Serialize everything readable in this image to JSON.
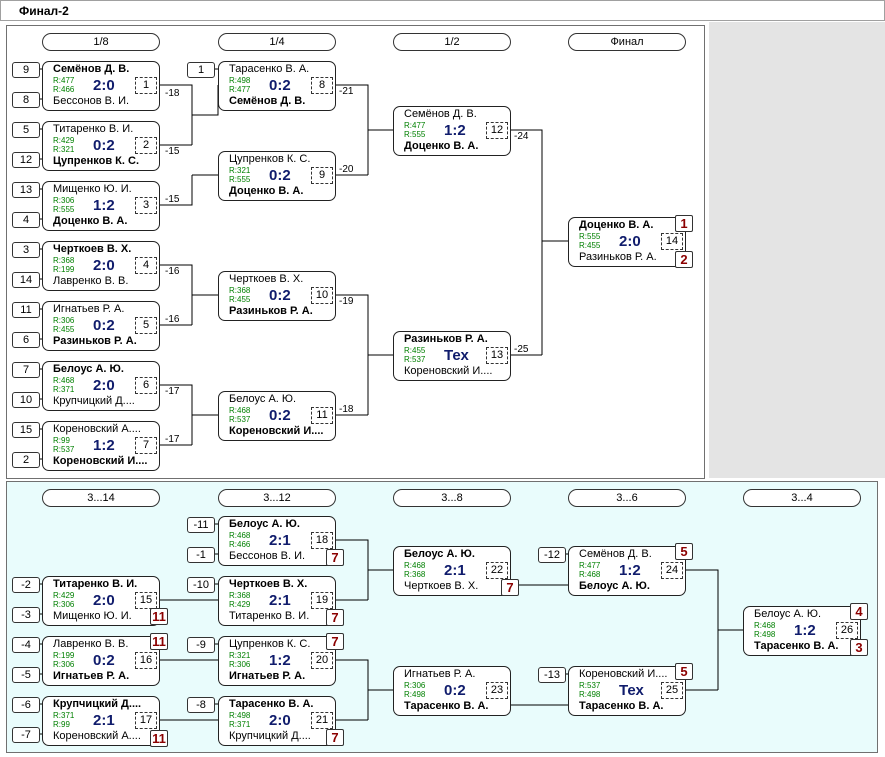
{
  "title": "Финал-2",
  "main_rounds": [
    "1/8",
    "1/4",
    "1/2",
    "Финал"
  ],
  "cons_rounds": [
    "3...14",
    "3...12",
    "3...8",
    "3...6",
    "3...4"
  ],
  "matches": [
    {
      "id": "m1",
      "p1": "Семёнов Д. В.",
      "p2": "Бессонов В. И.",
      "r1": "R:477",
      "r2": "R:466",
      "score": "2:0",
      "num": "1",
      "winner": 1
    },
    {
      "id": "m2",
      "p1": "Титаренко В. И.",
      "p2": "Цупренков К. С.",
      "r1": "R:429",
      "r2": "R:321",
      "score": "0:2",
      "num": "2",
      "winner": 2
    },
    {
      "id": "m3",
      "p1": "Мищенко Ю. И.",
      "p2": "Доценко В. А.",
      "r1": "R:306",
      "r2": "R:555",
      "score": "1:2",
      "num": "3",
      "winner": 2
    },
    {
      "id": "m4",
      "p1": "Черткоев В. Х.",
      "p2": "Лавренко В. В.",
      "r1": "R:368",
      "r2": "R:199",
      "score": "2:0",
      "num": "4",
      "winner": 1
    },
    {
      "id": "m5",
      "p1": "Игнатьев Р. А.",
      "p2": "Разиньков Р. А.",
      "r1": "R:306",
      "r2": "R:455",
      "score": "0:2",
      "num": "5",
      "winner": 2
    },
    {
      "id": "m6",
      "p1": "Белоус А. Ю.",
      "p2": "Крупчицкий Д....",
      "r1": "R:468",
      "r2": "R:371",
      "score": "2:0",
      "num": "6",
      "winner": 1
    },
    {
      "id": "m7",
      "p1": "Кореновский А....",
      "p2": "Кореновский И....",
      "r1": "R:99",
      "r2": "R:537",
      "score": "1:2",
      "num": "7",
      "winner": 2
    },
    {
      "id": "m8",
      "p1": "Тарасенко В. А.",
      "p2": "Семёнов Д. В.",
      "r1": "R:498",
      "r2": "R:477",
      "score": "0:2",
      "num": "8",
      "winner": 2
    },
    {
      "id": "m9",
      "p1": "Цупренков К. С.",
      "p2": "Доценко В. А.",
      "r1": "R:321",
      "r2": "R:555",
      "score": "0:2",
      "num": "9",
      "winner": 2
    },
    {
      "id": "m10",
      "p1": "Черткоев В. Х.",
      "p2": "Разиньков Р. А.",
      "r1": "R:368",
      "r2": "R:455",
      "score": "0:2",
      "num": "10",
      "winner": 2
    },
    {
      "id": "m11",
      "p1": "Белоус А. Ю.",
      "p2": "Кореновский И....",
      "r1": "R:468",
      "r2": "R:537",
      "score": "0:2",
      "num": "11",
      "winner": 2
    },
    {
      "id": "m12",
      "p1": "Семёнов Д. В.",
      "p2": "Доценко В. А.",
      "r1": "R:477",
      "r2": "R:555",
      "score": "1:2",
      "num": "12",
      "winner": 2
    },
    {
      "id": "m13",
      "p1": "Разиньков Р. А.",
      "p2": "Кореновский И....",
      "r1": "R:455",
      "r2": "R:537",
      "score": "Тех",
      "num": "13",
      "winner": 1
    },
    {
      "id": "m14",
      "p1": "Доценко В. А.",
      "p2": "Разиньков Р. А.",
      "r1": "R:555",
      "r2": "R:455",
      "score": "2:0",
      "num": "14",
      "winner": 1
    },
    {
      "id": "m15",
      "p1": "Титаренко В. И.",
      "p2": "Мищенко Ю. И.",
      "r1": "R:429",
      "r2": "R:306",
      "score": "2:0",
      "num": "15",
      "winner": 1
    },
    {
      "id": "m16",
      "p1": "Лавренко В. В.",
      "p2": "Игнатьев Р. А.",
      "r1": "R:199",
      "r2": "R:306",
      "score": "0:2",
      "num": "16",
      "winner": 2
    },
    {
      "id": "m17",
      "p1": "Крупчицкий Д....",
      "p2": "Кореновский А....",
      "r1": "R:371",
      "r2": "R:99",
      "score": "2:1",
      "num": "17",
      "winner": 1
    },
    {
      "id": "m18",
      "p1": "Белоус А. Ю.",
      "p2": "Бессонов В. И.",
      "r1": "R:468",
      "r2": "R:466",
      "score": "2:1",
      "num": "18",
      "winner": 1
    },
    {
      "id": "m19",
      "p1": "Черткоев В. Х.",
      "p2": "Титаренко В. И.",
      "r1": "R:368",
      "r2": "R:429",
      "score": "2:1",
      "num": "19",
      "winner": 1
    },
    {
      "id": "m20",
      "p1": "Цупренков К. С.",
      "p2": "Игнатьев Р. А.",
      "r1": "R:321",
      "r2": "R:306",
      "score": "1:2",
      "num": "20",
      "winner": 2
    },
    {
      "id": "m21",
      "p1": "Тарасенко В. А.",
      "p2": "Крупчицкий Д....",
      "r1": "R:498",
      "r2": "R:371",
      "score": "2:0",
      "num": "21",
      "winner": 1
    },
    {
      "id": "m22",
      "p1": "Белоус А. Ю.",
      "p2": "Черткоев В. Х.",
      "r1": "R:468",
      "r2": "R:368",
      "score": "2:1",
      "num": "22",
      "winner": 1
    },
    {
      "id": "m23",
      "p1": "Игнатьев Р. А.",
      "p2": "Тарасенко В. А.",
      "r1": "R:306",
      "r2": "R:498",
      "score": "0:2",
      "num": "23",
      "winner": 2
    },
    {
      "id": "m24",
      "p1": "Семёнов Д. В.",
      "p2": "Белоус А. Ю.",
      "r1": "R:477",
      "r2": "R:468",
      "score": "1:2",
      "num": "24",
      "winner": 2
    },
    {
      "id": "m25",
      "p1": "Кореновский И....",
      "p2": "Тарасенко В. А.",
      "r1": "R:537",
      "r2": "R:498",
      "score": "Тех",
      "num": "25",
      "winner": 2
    },
    {
      "id": "m26",
      "p1": "Белоус А. Ю.",
      "p2": "Тарасенко В. А.",
      "r1": "R:468",
      "r2": "R:498",
      "score": "1:2",
      "num": "26",
      "winner": 2
    }
  ],
  "seeds": [
    "9",
    "8",
    "5",
    "12",
    "13",
    "4",
    "3",
    "14",
    "11",
    "6",
    "7",
    "10",
    "15",
    "2",
    "1"
  ],
  "losers_labels": [
    "-18",
    "-15",
    "-15",
    "-16",
    "-16",
    "-17",
    "-17",
    "-21",
    "-20",
    "-19",
    "-18",
    "-24",
    "-25"
  ],
  "cons_entry_labels": [
    "-11",
    "-1",
    "-10",
    "-2",
    "-3",
    "-9",
    "-4",
    "-5",
    "-8",
    "-6",
    "-7",
    "-12",
    "-13"
  ],
  "places": [
    "1",
    "2",
    "7",
    "7",
    "11",
    "11",
    "7",
    "11",
    "7",
    "7",
    "5",
    "5",
    "4",
    "3"
  ]
}
